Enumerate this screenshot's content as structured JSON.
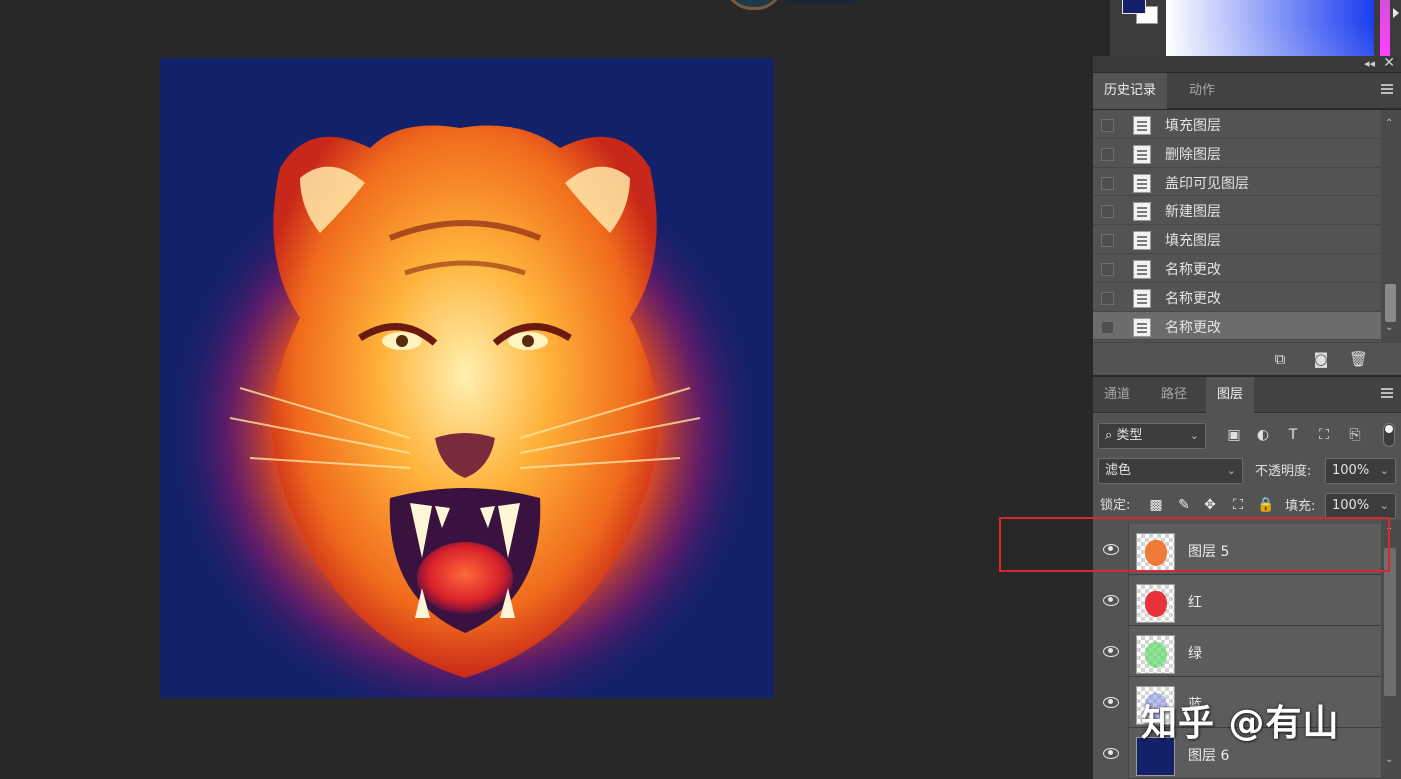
{
  "history_panel": {
    "tabs": [
      "历史记录",
      "动作"
    ],
    "items": [
      "填充图层",
      "删除图层",
      "盖印可见图层",
      "新建图层",
      "填充图层",
      "名称更改",
      "名称更改",
      "名称更改"
    ],
    "selected_index": 7
  },
  "layers_panel": {
    "tabs": [
      "通道",
      "路径",
      "图层"
    ],
    "active_tab": "图层",
    "filter_kind": "类型",
    "blend_mode": "滤色",
    "opacity_label": "不透明度:",
    "opacity_value": "100%",
    "lock_label": "锁定:",
    "fill_label": "填充:",
    "fill_value": "100%",
    "layers": [
      {
        "name": "图层 5",
        "thumb_color": "#f07a3a",
        "visible": true
      },
      {
        "name": "红",
        "thumb_color": "#e8323a",
        "visible": true
      },
      {
        "name": "绿",
        "thumb_color": "#5fd86a",
        "visible": true
      },
      {
        "name": "蓝",
        "thumb_color": "#7a86e0",
        "visible": true
      },
      {
        "name": "图层 6",
        "thumb_color": "#13206a",
        "visible": true
      }
    ]
  },
  "colors": {
    "foreground": "#13206a",
    "background": "#ffffff",
    "canvas_bg": "#13206a",
    "highlight": "#d42a2a"
  },
  "watermark": "知乎 @有山"
}
